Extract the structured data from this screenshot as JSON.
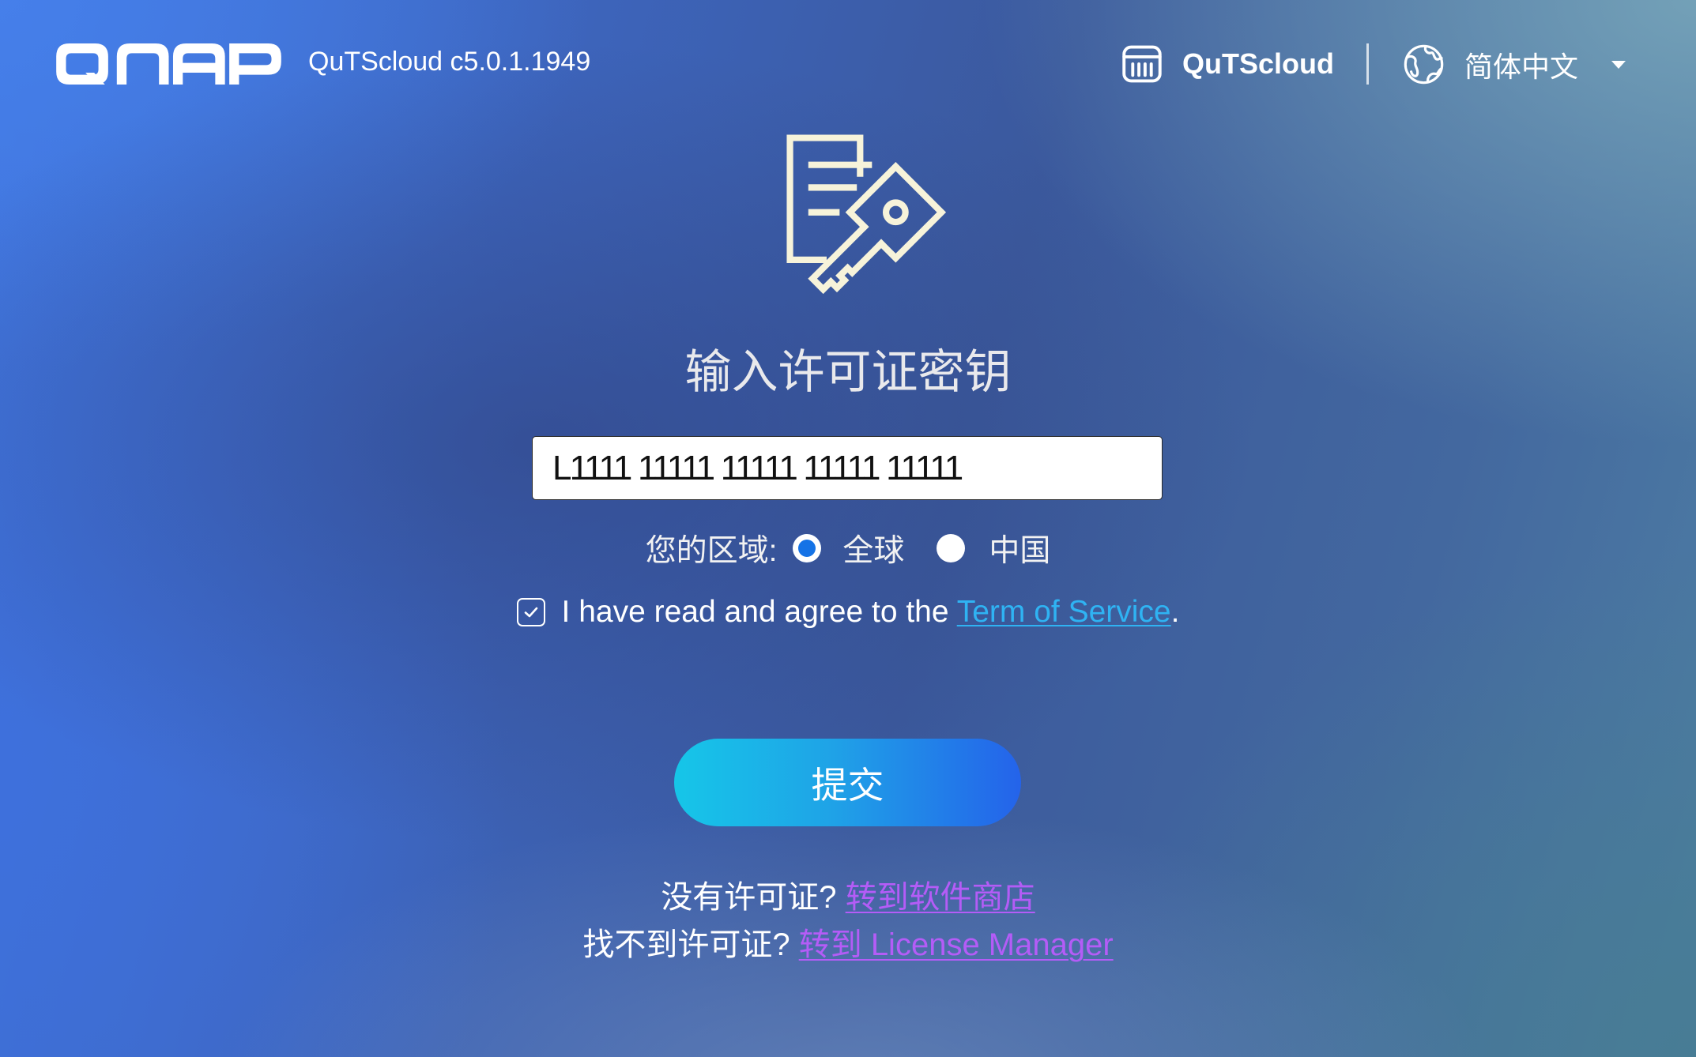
{
  "header": {
    "logo_text": "QNAP",
    "version": "QuTScloud c5.0.1.1949",
    "product_name": "QuTScloud",
    "language": "简体中文"
  },
  "main": {
    "title": "输入许可证密钥",
    "license_key": {
      "value": "L1111 11111 11111 11111 11111"
    },
    "region": {
      "label": "您的区域:",
      "options": [
        {
          "label": "全球",
          "selected": true
        },
        {
          "label": "中国",
          "selected": false
        }
      ]
    },
    "agreement": {
      "checked": true,
      "text": "I have read and agree to the",
      "link_label": "Term of Service",
      "suffix": "."
    },
    "submit_label": "提交",
    "no_license": {
      "text": "没有许可证?",
      "link_label": "转到软件商店"
    },
    "license_not_found": {
      "text": "找不到许可证?",
      "link_label": "转到 License Manager"
    }
  },
  "icons": {
    "product": "nas-device-icon",
    "language": "globe-icon",
    "language_dropdown": "caret-down-icon",
    "hero": "license-key-icon",
    "agreement_checkbox": "checkmark-icon"
  },
  "colors": {
    "button_gradient_start": "#16c6e8",
    "button_gradient_end": "#2463ea",
    "terms_link": "#2fb3f3",
    "secondary_link": "#b45cf7",
    "radio_selected": "#1573e6",
    "hero_icon": "#f7f3da",
    "background_primary": "#3d64bb"
  }
}
